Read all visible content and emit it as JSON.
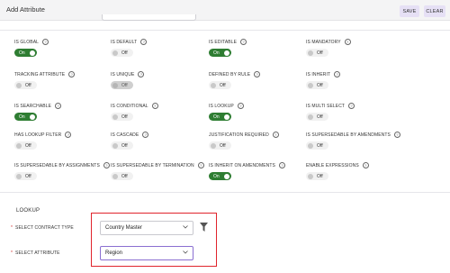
{
  "header": {
    "title": "Add Attribute",
    "save_label": "SAVE",
    "clear_label": "CLEAR"
  },
  "toggles": [
    {
      "label": "IS GLOBAL",
      "state": "On"
    },
    {
      "label": "IS DEFAULT",
      "state": "Off"
    },
    {
      "label": "IS EDITABLE",
      "state": "On"
    },
    {
      "label": "IS MANDATORY",
      "state": "Off"
    },
    {
      "label": "TRACKING ATTRIBUTE",
      "state": "Off"
    },
    {
      "label": "IS UNIQUE",
      "state": "Off"
    },
    {
      "label": "DEFINED BY RULE",
      "state": "Off"
    },
    {
      "label": "IS INHERIT",
      "state": "Off"
    },
    {
      "label": "IS SEARCHABLE",
      "state": "On"
    },
    {
      "label": "IS CONDITIONAL",
      "state": "Off"
    },
    {
      "label": "IS LOOKUP",
      "state": "On"
    },
    {
      "label": "IS MULTI SELECT",
      "state": "Off"
    },
    {
      "label": "HAS LOOKUP FILTER",
      "state": "Off"
    },
    {
      "label": "IS CASCADE",
      "state": "Off"
    },
    {
      "label": "JUSTIFICATION REQUIRED",
      "state": "Off"
    },
    {
      "label": "IS SUPERSEDABLE BY AMENDMENTS",
      "state": "Off"
    },
    {
      "label": "IS SUPERSEDABLE BY ASSIGNMENTS",
      "state": "Off"
    },
    {
      "label": "IS SUPERSEDABLE BY TERMINATION",
      "state": "Off"
    },
    {
      "label": "IS INHERIT ON AMENDMENTS",
      "state": "On"
    },
    {
      "label": "ENABLE EXPRESSIONS",
      "state": "Off"
    }
  ],
  "lookup": {
    "title": "LOOKUP",
    "contract_type_label": "SELECT CONTRACT TYPE",
    "contract_type_value": "Country Master",
    "attribute_label": "SELECT ATTRIBUTE",
    "attribute_value": "Region",
    "required_mark": "*"
  },
  "colors": {
    "on": "#2e7d32",
    "accent": "#8a6fd1",
    "highlight": "#e0242c",
    "button_bg": "#e6e0f5"
  },
  "icons": [
    "help-icon",
    "filter-icon",
    "chevron-down-icon"
  ]
}
